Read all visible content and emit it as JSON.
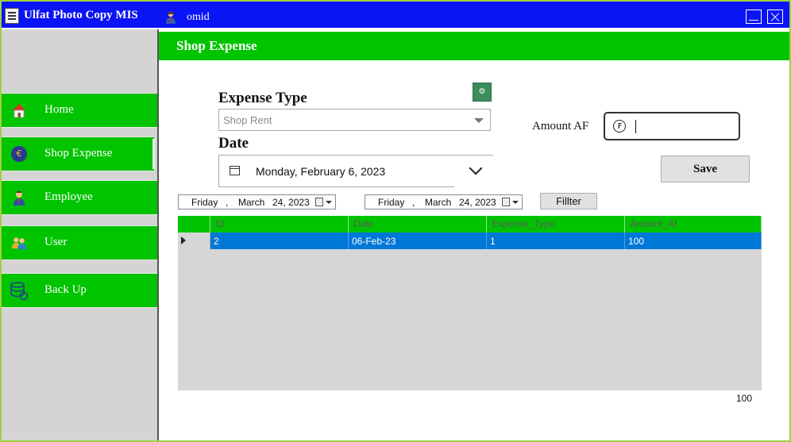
{
  "window": {
    "title": "Ulfat Photo Copy MIS",
    "user": "omid"
  },
  "sidebar": {
    "items": [
      {
        "label": "Home",
        "icon": "home-icon"
      },
      {
        "label": "Shop Expense",
        "icon": "euro-coin-icon"
      },
      {
        "label": "Employee",
        "icon": "employee-icon"
      },
      {
        "label": "User",
        "icon": "users-icon"
      },
      {
        "label": "Back Up",
        "icon": "database-backup-icon"
      }
    ],
    "active": "Shop Expense"
  },
  "page": {
    "title": "Shop Expense",
    "expense_type_label": "Expense Type",
    "expense_type_value": "Shop Rent",
    "date_label": "Date",
    "date_value": "Monday, February 6, 2023",
    "amount_label": "Amount AF",
    "amount_value": "",
    "save_label": "Save",
    "filter_from": {
      "day": "Friday",
      "month": "March",
      "date": "24, 2023"
    },
    "filter_to": {
      "day": "Friday",
      "month": "March",
      "date": "24, 2023"
    },
    "filter_label": "Fillter",
    "total": "100"
  },
  "table": {
    "columns": [
      "ID",
      "Date",
      "Expense_Type",
      "Amount_Af"
    ],
    "rows": [
      [
        "2",
        "06-Feb-23",
        "1",
        "100"
      ]
    ]
  },
  "colors": {
    "titlebar": "#0a14f5",
    "accent_green": "#00c400",
    "selection_blue": "#0078d7",
    "sidebar_bg": "#d4d4d4"
  }
}
